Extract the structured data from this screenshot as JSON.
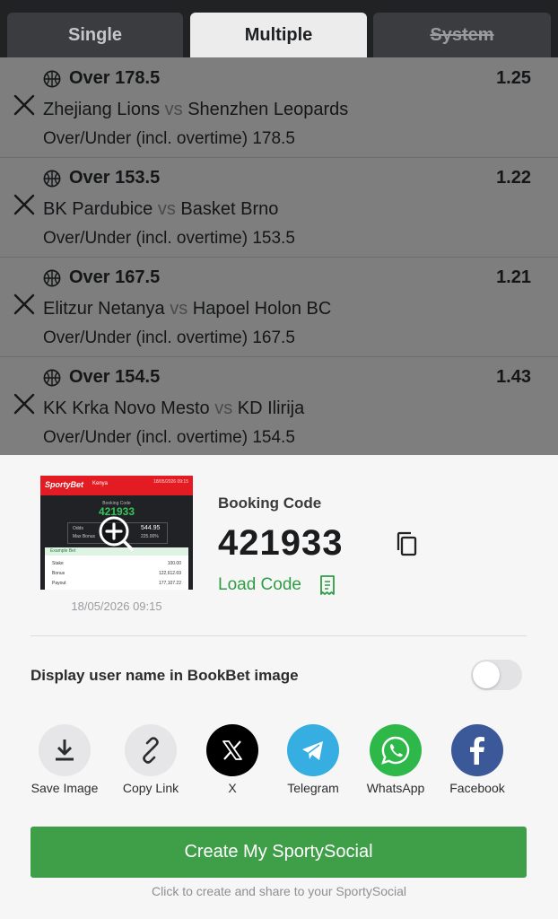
{
  "tabs": [
    {
      "label": "Single",
      "active": false
    },
    {
      "label": "Multiple",
      "active": true
    },
    {
      "label": "System",
      "active": false,
      "disabled": true
    }
  ],
  "bets": [
    {
      "pick": "Over 178.5",
      "odds": "1.25",
      "home": "Zhejiang Lions",
      "vs": "vs",
      "away": "Shenzhen Leopards",
      "market": "Over/Under (incl. overtime) 178.5",
      "sport_icon": "basketball-icon"
    },
    {
      "pick": "Over 153.5",
      "odds": "1.22",
      "home": "BK Pardubice",
      "vs": "vs",
      "away": "Basket Brno",
      "market": "Over/Under (incl. overtime) 153.5",
      "sport_icon": "basketball-icon"
    },
    {
      "pick": "Over 167.5",
      "odds": "1.21",
      "home": "Elitzur Netanya",
      "vs": "vs",
      "away": "Hapoel Holon BC",
      "market": "Over/Under (incl. overtime) 167.5",
      "sport_icon": "basketball-icon"
    },
    {
      "pick": "Over 154.5",
      "odds": "1.43",
      "home": "KK Krka Novo Mesto",
      "vs": "vs",
      "away": "KD Ilirija",
      "market": "Over/Under (incl. overtime) 154.5",
      "sport_icon": "basketball-icon"
    }
  ],
  "share_sheet": {
    "thumbnail": {
      "brand": "SportyBet",
      "region": "Kenya",
      "header_date": "18/05/2026 09:15",
      "label": "Booking Code",
      "code": "421933",
      "odds_label": "Odds",
      "odds_value": "544.95",
      "max_bonus_label": "Max Bonus",
      "max_bonus_value": "225.00%",
      "example_label": "Example Bet",
      "rows": [
        {
          "label": "Stake",
          "value": "100.00"
        },
        {
          "label": "Bonus",
          "value": "122,612.69"
        },
        {
          "label": "Payout",
          "value": "177,107.22"
        }
      ],
      "date": "18/05/2026 09:15"
    },
    "booking_label": "Booking Code",
    "booking_code": "421933",
    "load_code_label": "Load Code",
    "display_username_label": "Display user name in BookBet image",
    "display_username_on": false,
    "share_targets": [
      {
        "label": "Save Image",
        "icon": "download-icon"
      },
      {
        "label": "Copy Link",
        "icon": "link-icon"
      },
      {
        "label": "X",
        "icon": "x-logo-icon"
      },
      {
        "label": "Telegram",
        "icon": "telegram-icon"
      },
      {
        "label": "WhatsApp",
        "icon": "whatsapp-icon"
      },
      {
        "label": "Facebook",
        "icon": "facebook-icon"
      }
    ],
    "create_button_label": "Create My SportySocial",
    "create_hint": "Click to create and share to your SportySocial"
  },
  "colors": {
    "accent_green": "#3f9f49",
    "load_code_green": "#2e9d44",
    "brand_red": "#e31c23",
    "telegram_blue": "#37aee2",
    "whatsapp_green": "#2fb84a",
    "facebook_blue": "#3b5998"
  }
}
